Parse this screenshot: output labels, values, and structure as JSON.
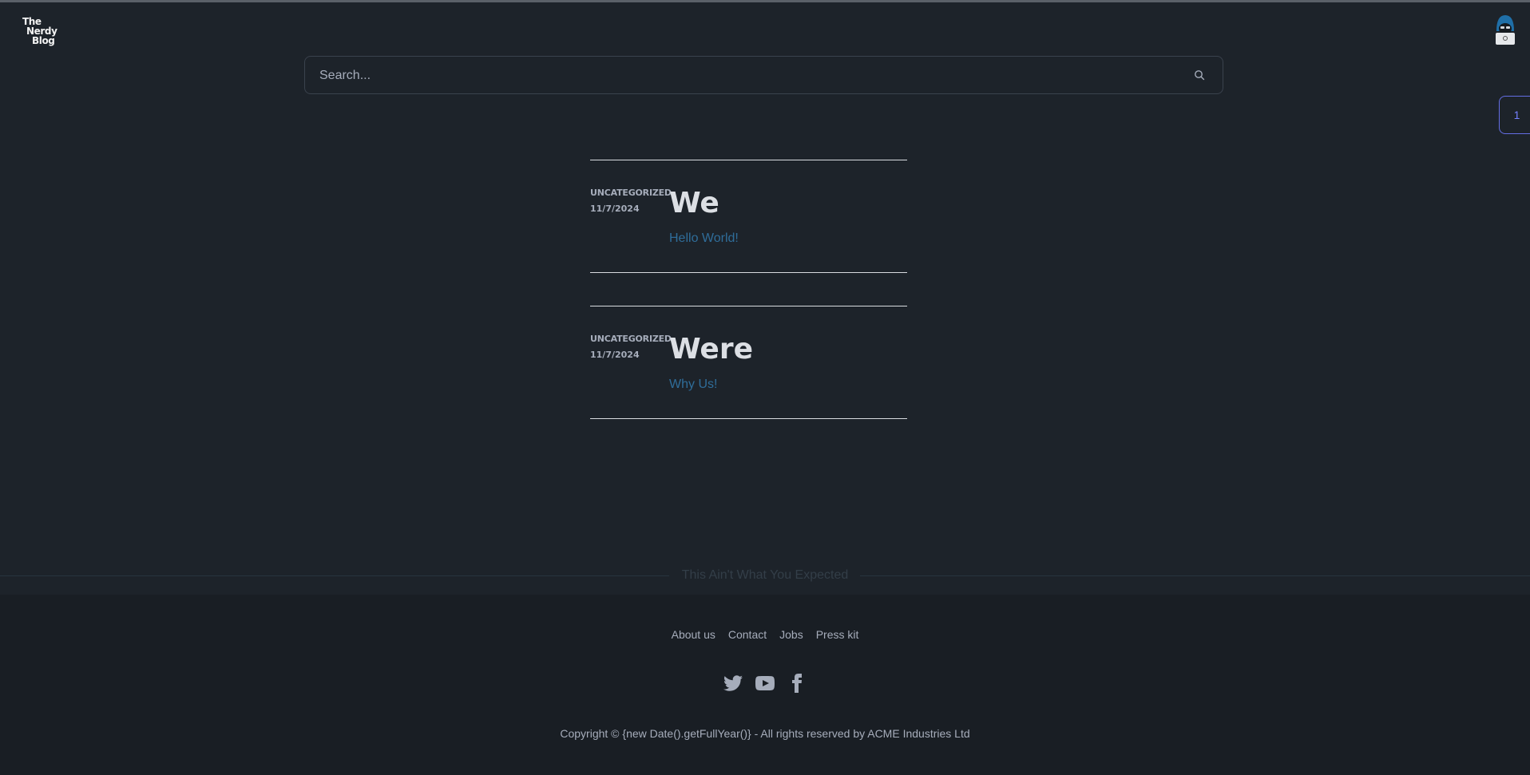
{
  "brand": {
    "line1": "The",
    "line2": "Nerdy",
    "line3": "Blog"
  },
  "search": {
    "placeholder": "Search..."
  },
  "pagination": {
    "current": "1"
  },
  "posts": [
    {
      "category": "UNCATEGORIZED",
      "date": "11/7/2024",
      "title": "We",
      "link": "Hello World!"
    },
    {
      "category": "UNCATEGORIZED",
      "date": "11/7/2024",
      "title": "Were",
      "link": "Why Us!"
    }
  ],
  "divider": {
    "text": "This Ain't What You Expected"
  },
  "footer": {
    "links": [
      "About us",
      "Contact",
      "Jobs",
      "Press kit"
    ],
    "social": [
      "twitter-icon",
      "youtube-icon",
      "facebook-icon"
    ],
    "copyright": "Copyright © {new Date().getFullYear()} - All rights reserved by ACME Industries Ltd"
  },
  "colors": {
    "background": "#1d232a",
    "footer_background": "#191e24",
    "link": "#2f6d9a",
    "accent": "#646ee4"
  }
}
